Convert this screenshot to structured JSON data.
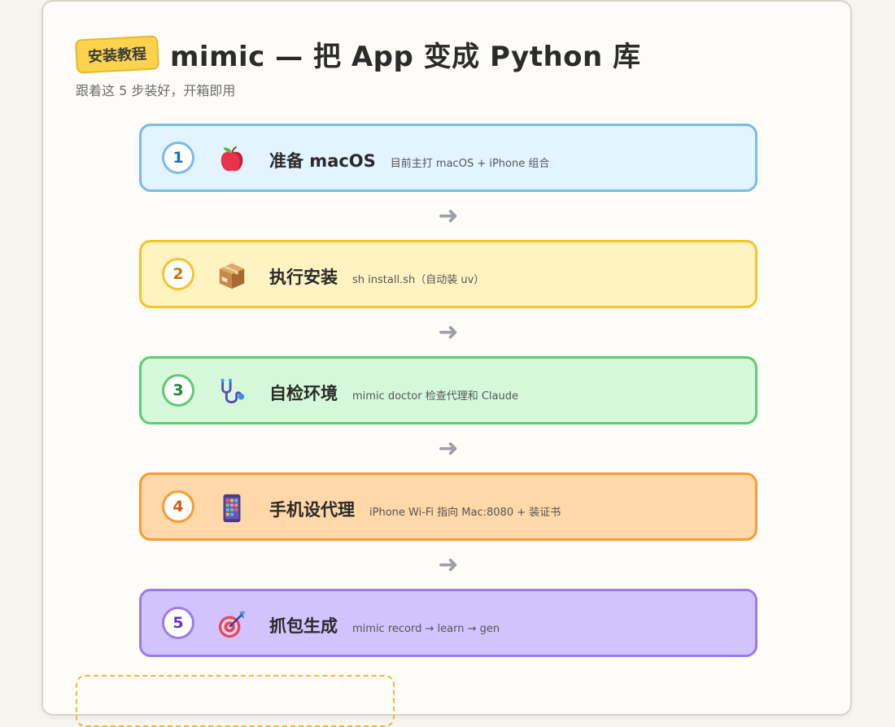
{
  "header": {
    "badge": "安装教程",
    "title": "mimic — 把 App 变成 Python 库",
    "subtitle": "跟着这 5 步装好，开箱即用"
  },
  "steps": [
    {
      "num": "1",
      "icon": "apple-icon",
      "title": "准备 macOS",
      "desc": "目前主打 macOS + iPhone 组合"
    },
    {
      "num": "2",
      "icon": "package-icon",
      "title": "执行安装",
      "desc": "sh install.sh（自动装 uv）"
    },
    {
      "num": "3",
      "icon": "stethoscope-icon",
      "title": "自检环境",
      "desc": "mimic doctor 检查代理和 Claude"
    },
    {
      "num": "4",
      "icon": "phone-icon",
      "title": "手机设代理",
      "desc": "iPhone Wi-Fi 指向 Mac:8080 + 装证书"
    },
    {
      "num": "5",
      "icon": "target-icon",
      "title": "抓包生成",
      "desc": "mimic record → learn → gen"
    }
  ],
  "arrow": "➜",
  "colors": {
    "step1": "#79bbe9",
    "step2": "#f4c427",
    "step3": "#5fcb6d",
    "step4": "#f89a39",
    "step5": "#9b7bea"
  }
}
